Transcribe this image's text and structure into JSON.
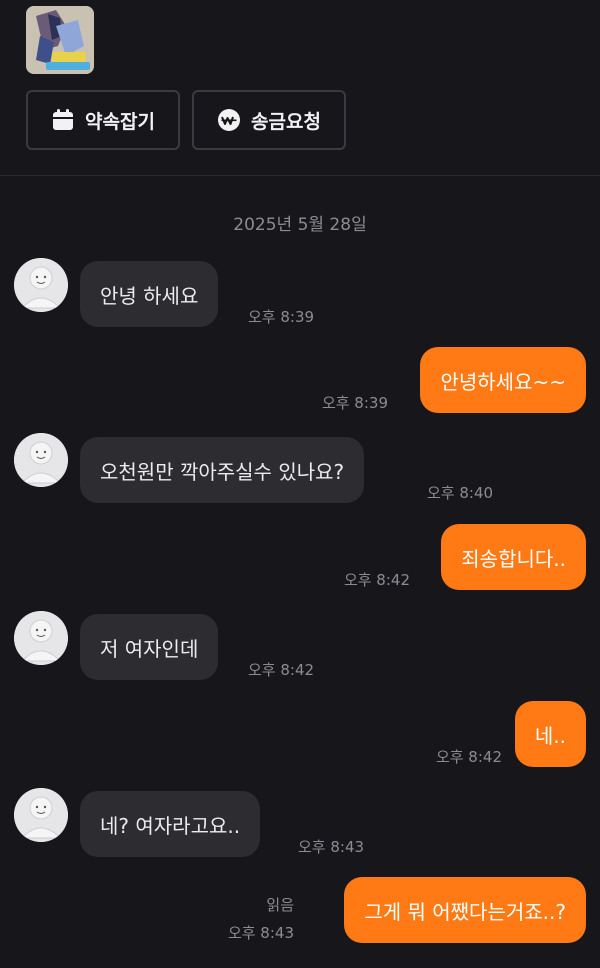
{
  "header": {
    "buttons": [
      {
        "label": "약속잡기",
        "icon": "calendar-icon"
      },
      {
        "label": "송금요청",
        "icon": "won-pay-icon"
      }
    ]
  },
  "chat": {
    "date": "2025년 5월 28일",
    "messages": [
      {
        "side": "in",
        "text": "안녕 하세요",
        "time": "오후 8:39"
      },
      {
        "side": "out",
        "text": "안녕하세요~~",
        "time": "오후 8:39"
      },
      {
        "side": "in",
        "text": "오천원만 깍아주실수 있나요?",
        "time": "오후 8:40"
      },
      {
        "side": "out",
        "text": "죄송합니다..",
        "time": "오후 8:42"
      },
      {
        "side": "in",
        "text": "저 여자인데",
        "time": "오후 8:42"
      },
      {
        "side": "out",
        "text": "네..",
        "time": "오후 8:42"
      },
      {
        "side": "in",
        "text": "네? 여자라고요..",
        "time": "오후 8:43"
      },
      {
        "side": "out",
        "text": "그게 뭐 어쨌다는거죠..?",
        "time": "오후 8:43",
        "read": "읽음"
      }
    ]
  },
  "colors": {
    "background": "#17171b",
    "incoming_bubble": "#2c2c31",
    "outgoing_bubble": "#ff7a14",
    "muted_text": "#8b8b92"
  }
}
